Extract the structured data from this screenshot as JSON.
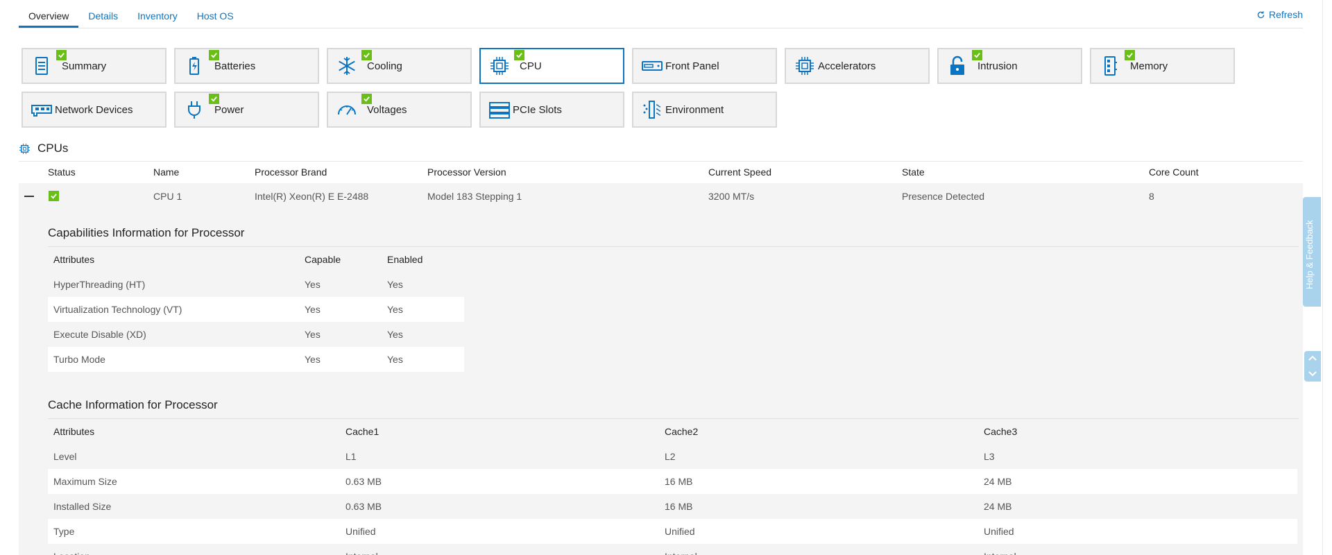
{
  "tabs": [
    "Overview",
    "Details",
    "Inventory",
    "Host OS"
  ],
  "refresh_label": "Refresh",
  "tiles": [
    {
      "label": "Summary",
      "icon": "summary-icon",
      "check": true
    },
    {
      "label": "Batteries",
      "icon": "battery-icon",
      "check": true
    },
    {
      "label": "Cooling",
      "icon": "snowflake-icon",
      "check": true
    },
    {
      "label": "CPU",
      "icon": "chip-icon",
      "check": true,
      "selected": true
    },
    {
      "label": "Front Panel",
      "icon": "front-panel-icon",
      "check": false
    },
    {
      "label": "Accelerators",
      "icon": "chip-icon",
      "check": false
    },
    {
      "label": "Intrusion",
      "icon": "lock-icon",
      "check": true
    },
    {
      "label": "Memory",
      "icon": "memory-icon",
      "check": true
    },
    {
      "label": "Network Devices",
      "icon": "network-card-icon",
      "check": false
    },
    {
      "label": "Power",
      "icon": "plug-icon",
      "check": true
    },
    {
      "label": "Voltages",
      "icon": "gauge-icon",
      "check": true
    },
    {
      "label": "PCIe Slots",
      "icon": "pcie-icon",
      "check": false
    },
    {
      "label": "Environment",
      "icon": "environment-icon",
      "check": false
    }
  ],
  "colors": {
    "accent": "#0b75c4",
    "ok": "#6abf17"
  },
  "cpus": {
    "title": "CPUs",
    "headers": [
      "Status",
      "Name",
      "Processor Brand",
      "Processor Version",
      "Current Speed",
      "State",
      "Core Count"
    ],
    "row": {
      "name": "CPU 1",
      "brand": "Intel(R) Xeon(R) E E-2488",
      "version": "Model 183 Stepping 1",
      "speed": "3200 MT/s",
      "state": "Presence Detected",
      "cores": "8"
    }
  },
  "capabilities": {
    "title": "Capabilities Information for Processor",
    "headers": [
      "Attributes",
      "Capable",
      "Enabled"
    ],
    "rows": [
      [
        "HyperThreading (HT)",
        "Yes",
        "Yes"
      ],
      [
        "Virtualization Technology (VT)",
        "Yes",
        "Yes"
      ],
      [
        "Execute Disable (XD)",
        "Yes",
        "Yes"
      ],
      [
        "Turbo Mode",
        "Yes",
        "Yes"
      ]
    ]
  },
  "cache": {
    "title": "Cache Information for Processor",
    "headers": [
      "Attributes",
      "Cache1",
      "Cache2",
      "Cache3"
    ],
    "rows": [
      [
        "Level",
        "L1",
        "L2",
        "L3"
      ],
      [
        "Maximum Size",
        "0.63 MB",
        "16 MB",
        "24 MB"
      ],
      [
        "Installed Size",
        "0.63 MB",
        "16 MB",
        "24 MB"
      ],
      [
        "Type",
        "Unified",
        "Unified",
        "Unified"
      ],
      [
        "Location",
        "Internal",
        "Internal",
        "Internal"
      ]
    ]
  },
  "help_label": "Help & Feedback"
}
